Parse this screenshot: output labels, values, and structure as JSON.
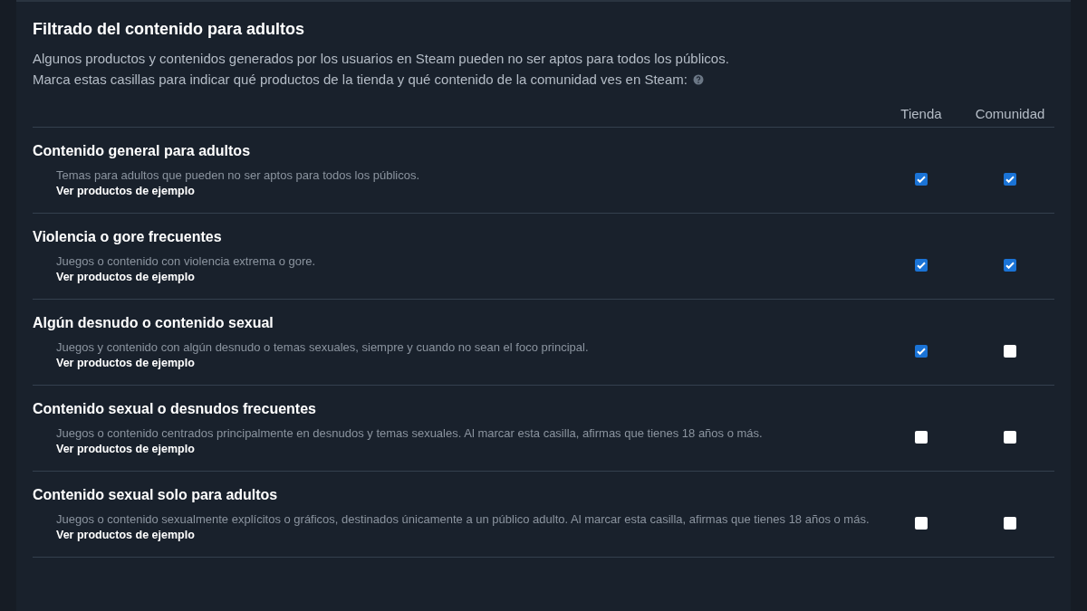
{
  "title": "Filtrado del contenido para adultos",
  "intro": [
    "Algunos productos y contenidos generados por los usuarios en Steam pueden no ser aptos para todos los públicos.",
    "Marca estas casillas para indicar qué productos de la tienda y qué contenido de la comunidad ves en Steam:"
  ],
  "columns": [
    "Tienda",
    "Comunidad"
  ],
  "rows": [
    {
      "title": "Contenido general para adultos",
      "description": "Temas para adultos que pueden no ser aptos para todos los públicos.",
      "link": "Ver productos de ejemplo",
      "checks": [
        {
          "checked": true
        },
        {
          "checked": true
        }
      ]
    },
    {
      "title": "Violencia o gore frecuentes",
      "description": "Juegos o contenido con violencia extrema o gore.",
      "link": "Ver productos de ejemplo",
      "checks": [
        {
          "checked": true
        },
        {
          "checked": true
        }
      ]
    },
    {
      "title": "Algún desnudo o contenido sexual",
      "description": "Juegos y contenido con algún desnudo o temas sexuales, siempre y cuando no sean el foco principal.",
      "link": "Ver productos de ejemplo",
      "checks": [
        {
          "checked": true
        },
        {
          "checked": false
        }
      ]
    },
    {
      "title": "Contenido sexual o desnudos frecuentes",
      "description": "Juegos o contenido centrados principalmente en desnudos y temas sexuales. Al marcar esta casilla, afirmas que tienes 18 años o más.",
      "link": "Ver productos de ejemplo",
      "checks": [
        {
          "checked": false
        },
        {
          "checked": false
        }
      ]
    },
    {
      "title": "Contenido sexual solo para adultos",
      "description": "Juegos o contenido sexualmente explícitos o gráficos, destinados únicamente a un público adulto. Al marcar esta casilla, afirmas que tienes 18 años o más.",
      "link": "Ver productos de ejemplo",
      "checks": [
        {
          "checked": false
        },
        {
          "checked": false
        }
      ]
    }
  ]
}
